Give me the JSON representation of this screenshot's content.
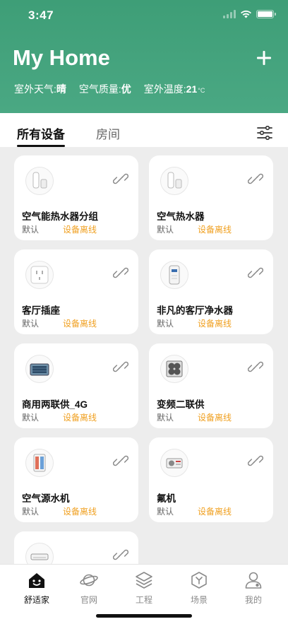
{
  "status_bar": {
    "time": "3:47"
  },
  "header": {
    "title": "My Home",
    "weather": {
      "label": "室外天气:",
      "value": "晴"
    },
    "air_quality": {
      "label": "空气质量:",
      "value": "优"
    },
    "temperature": {
      "label": "室外温度:",
      "value": "21",
      "unit": "°C"
    }
  },
  "tabs": {
    "all_devices": "所有设备",
    "rooms": "房间"
  },
  "devices": [
    {
      "name": "空气能热水器分组",
      "room": "默认",
      "status": "设备离线",
      "icon": "water-heater-icon"
    },
    {
      "name": "空气热水器",
      "room": "默认",
      "status": "设备离线",
      "icon": "water-heater-icon"
    },
    {
      "name": "客厅插座",
      "room": "默认",
      "status": "设备离线",
      "icon": "socket-icon"
    },
    {
      "name": "非凡的客厅净水器",
      "room": "默认",
      "status": "设备离线",
      "icon": "water-purifier-icon"
    },
    {
      "name": "商用两联供_4G",
      "room": "默认",
      "status": "设备离线",
      "icon": "commercial-unit-icon"
    },
    {
      "name": "变频二联供",
      "room": "默认",
      "status": "设备离线",
      "icon": "dual-supply-unit-icon"
    },
    {
      "name": "空气源水机",
      "room": "默认",
      "status": "设备离线",
      "icon": "air-source-unit-icon"
    },
    {
      "name": "氟机",
      "room": "默认",
      "status": "设备离线",
      "icon": "fluorine-unit-icon"
    },
    {
      "name": "",
      "room": "",
      "status": "",
      "icon": "air-conditioner-icon"
    }
  ],
  "tabbar": [
    {
      "label": "舒适家",
      "icon": "home-icon",
      "active": true
    },
    {
      "label": "官网",
      "icon": "planet-icon",
      "active": false
    },
    {
      "label": "工程",
      "icon": "layers-icon",
      "active": false
    },
    {
      "label": "场景",
      "icon": "scene-icon",
      "active": false
    },
    {
      "label": "我的",
      "icon": "user-icon",
      "active": false
    }
  ],
  "colors": {
    "header_green": "#3e9e77",
    "offline_orange": "#f0a020",
    "background": "#ededed"
  }
}
